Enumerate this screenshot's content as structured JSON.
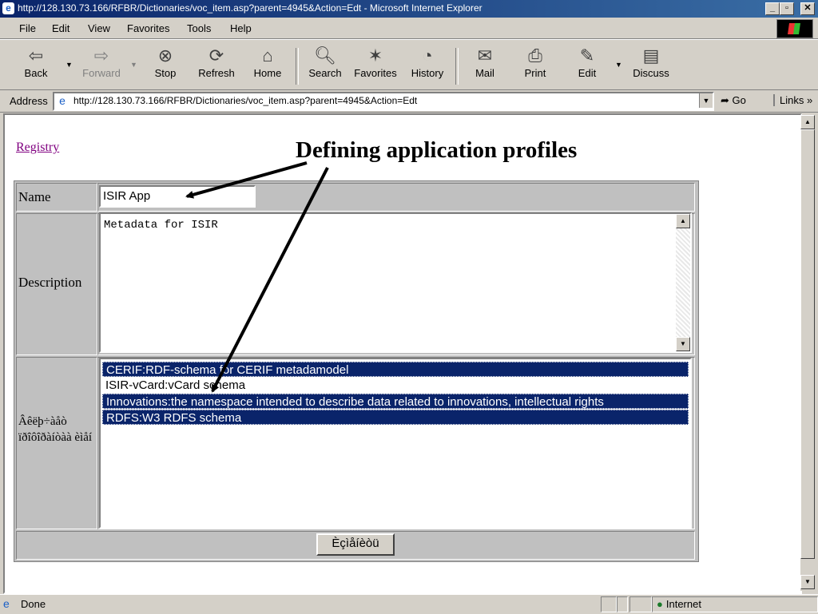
{
  "window": {
    "title": "http://128.130.73.166/RFBR/Dictionaries/voc_item.asp?parent=4945&Action=Edt - Microsoft Internet Explorer"
  },
  "menu": [
    "File",
    "Edit",
    "View",
    "Favorites",
    "Tools",
    "Help"
  ],
  "toolbar": {
    "back": "Back",
    "forward": "Forward",
    "stop": "Stop",
    "refresh": "Refresh",
    "home": "Home",
    "search": "Search",
    "favorites": "Favorites",
    "history": "History",
    "mail": "Mail",
    "print": "Print",
    "edit": "Edit",
    "discuss": "Discuss"
  },
  "address": {
    "label": "Address",
    "url": "http://128.130.73.166/RFBR/Dictionaries/voc_item.asp?parent=4945&Action=Edt",
    "go": "Go",
    "links": "Links"
  },
  "page": {
    "registry_link": "Registry",
    "annotation": "Defining application profiles",
    "form": {
      "name_label": "Name",
      "name_value": "ISIR App",
      "description_label": "Description",
      "description_value": "Metadata for ISIR",
      "schemas_label": "Âêëþ÷àåò ïðîôîðàíòàà èìåí",
      "schemas_options": [
        {
          "text": "CERIF:RDF-schema for CERIF metadamodel",
          "selected": true
        },
        {
          "text": "ISIR-vCard:vCard schema",
          "selected": false
        },
        {
          "text": "Innovations:the namespace intended to describe data related to innovations, intellectual rights",
          "selected": true
        },
        {
          "text": "RDFS:W3 RDFS schema",
          "selected": true
        }
      ],
      "submit_label": "Èçìåíèòü"
    }
  },
  "status": {
    "text": "Done",
    "zone": "Internet"
  }
}
